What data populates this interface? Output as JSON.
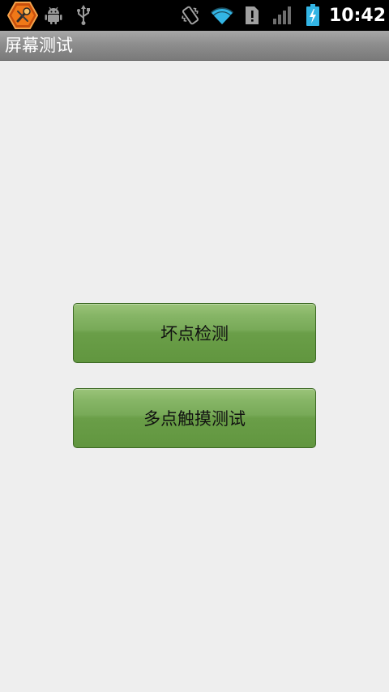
{
  "status_bar": {
    "icons": [
      "app-tool-icon",
      "android-debug-icon",
      "usb-icon",
      "vibrate-icon",
      "wifi-icon",
      "sim-alert-icon",
      "signal-icon",
      "battery-charging-icon"
    ],
    "time": "10:42"
  },
  "title_bar": {
    "title": "屏幕测试"
  },
  "main": {
    "buttons": [
      {
        "label": "坏点检测"
      },
      {
        "label": "多点触摸测试"
      }
    ]
  },
  "colors": {
    "status_bar_bg": "#000000",
    "title_bar_bg": "#8e8e8e",
    "page_bg": "#eeeeee",
    "button_green": "#78aa58",
    "battery_cyan": "#33b5e5",
    "wifi_cyan": "#33b5e5",
    "app_icon_orange": "#f07818"
  }
}
